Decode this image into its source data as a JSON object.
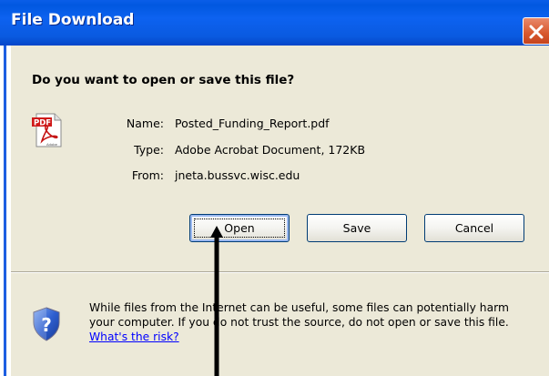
{
  "window": {
    "title": "File Download",
    "close_icon": "close-icon"
  },
  "dialog": {
    "question": "Do you want to open or save this file?",
    "file_icon": "pdf-file-icon",
    "fields": [
      {
        "label": "Name:",
        "value": "Posted_Funding_Report.pdf"
      },
      {
        "label": "Type:",
        "value": "Adobe Acrobat Document, 172KB"
      },
      {
        "label": "From:",
        "value": "jneta.bussvc.wisc.edu"
      }
    ],
    "buttons": {
      "open": "Open",
      "save": "Save",
      "cancel": "Cancel"
    },
    "warning": {
      "icon": "security-shield-icon",
      "text": "While files from the Internet can be useful, some files can potentially harm your computer. If you do not trust the source, do not open or save this file.",
      "link": "What's the risk?"
    }
  },
  "annotation": {
    "arrow": "pointer-arrow"
  },
  "colors": {
    "titlebar": "#0a5ee8",
    "dialog_bg": "#ece9d8",
    "close_button": "#d8582d",
    "link": "#0000ff"
  }
}
